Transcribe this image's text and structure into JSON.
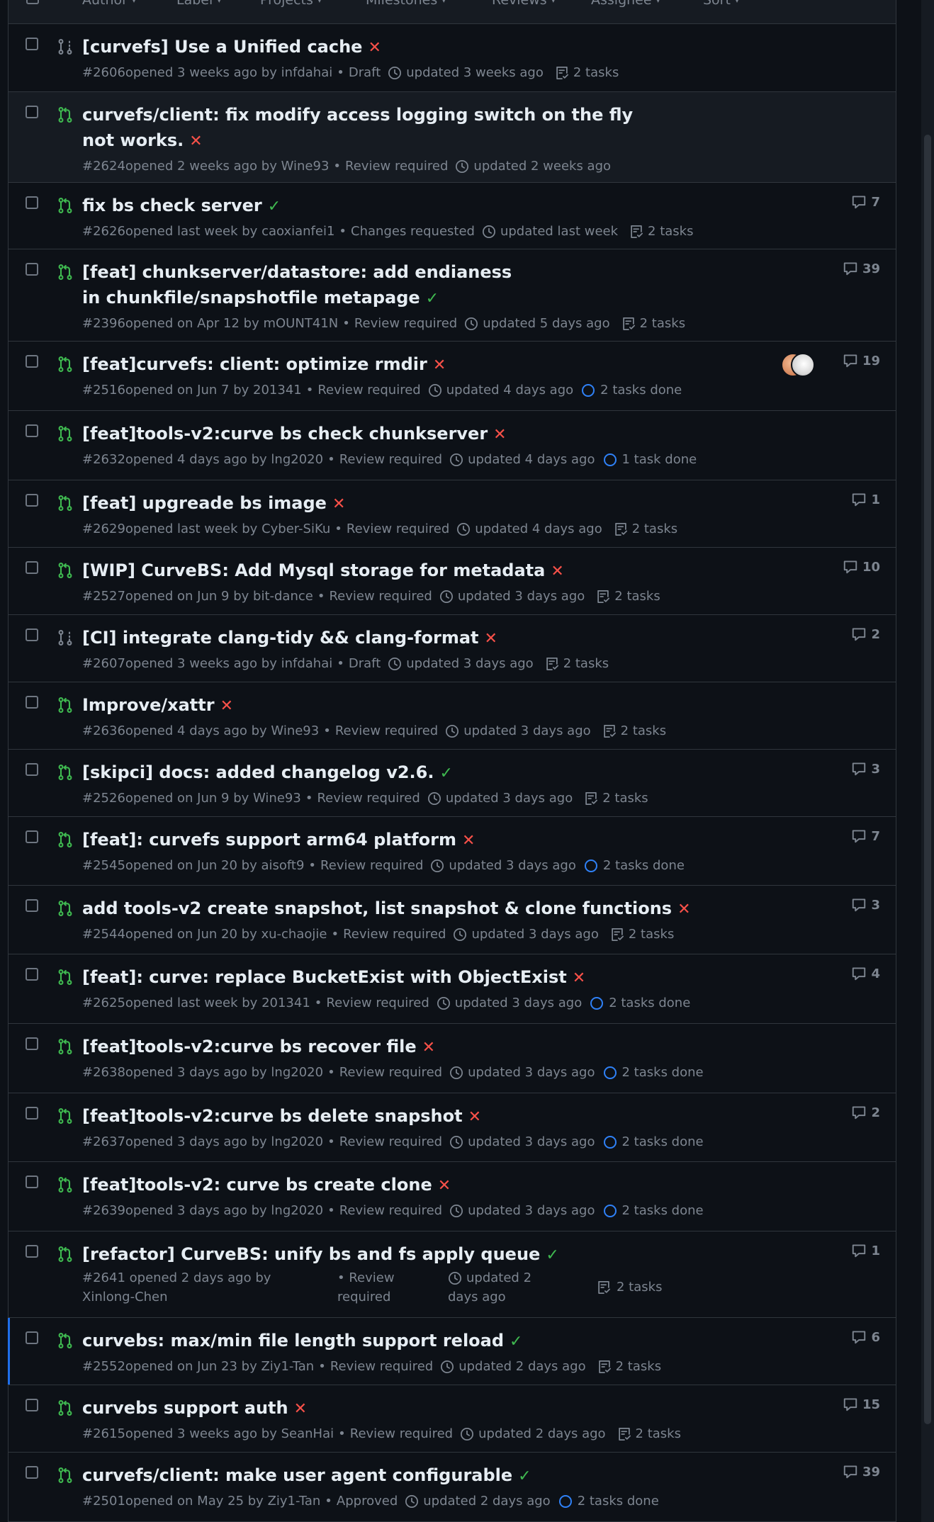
{
  "filter_bar": {
    "items": [
      "Author",
      "Label",
      "Projects",
      "Milestones",
      "Reviews",
      "Assignee",
      "Sort"
    ]
  },
  "colors": {
    "open_pr": "#3fb950",
    "draft_pr": "#7d8590",
    "failure": "#f85149",
    "success": "#3fb950",
    "tasks_done": "#2f81f7",
    "selected_accent": "#1f6feb"
  },
  "pull_requests": [
    {
      "title": "[curvefs] Use a Unified cache",
      "status": "fail",
      "number": "#2606",
      "opened": "opened 3 weeks ago by",
      "author": "infdahai",
      "review": "Draft",
      "updated": "updated 3 weeks ago",
      "tasks": "2 tasks",
      "tasks_icon": "checklist-icon",
      "comments": "",
      "draft": true
    },
    {
      "title": "curvefs/client: fix modify access logging switch on the fly not works.",
      "status": "fail",
      "number": "#2624",
      "opened": "opened 2 weeks ago by",
      "author": "Wine93",
      "review": "Review required",
      "updated": "updated 2 weeks ago",
      "tasks": "",
      "comments": ""
    },
    {
      "title": "fix bs check server",
      "status": "ok",
      "number": "#2626",
      "opened": "opened last week by",
      "author": "caoxianfei1",
      "review": "Changes requested",
      "updated": "updated last week",
      "tasks": "2 tasks",
      "tasks_icon": "checklist-icon",
      "comments": "7"
    },
    {
      "title": "[feat] chunkserver/datastore: add endianess in chunkfile/snapshotfile metapage",
      "status": "ok",
      "number": "#2396",
      "opened": "opened on Apr 12 by",
      "author": "mOUNT41N",
      "review": "Review required",
      "updated": "updated 5 days ago",
      "tasks": "2 tasks",
      "tasks_icon": "checklist-icon",
      "comments": "39"
    },
    {
      "title": "[feat]curvefs: client: optimize rmdir",
      "status": "fail",
      "number": "#2516",
      "opened": "opened on Jun 7 by",
      "author": "201341",
      "review": "Review required",
      "updated": "updated 4 days ago",
      "tasks": "2 tasks done",
      "tasks_icon": "tasks-done-icon",
      "comments": "19",
      "avatars": true
    },
    {
      "title": "[feat]tools-v2:curve bs check chunkserver",
      "status": "fail",
      "number": "#2632",
      "opened": "opened 4 days ago by",
      "author": "lng2020",
      "review": "Review required",
      "updated": "updated 4 days ago",
      "tasks": "1 task done",
      "tasks_icon": "tasks-done-icon",
      "comments": ""
    },
    {
      "title": "[feat] upgreade bs image",
      "status": "fail",
      "number": "#2629",
      "opened": "opened last week by",
      "author": "Cyber-SiKu",
      "review": "Review required",
      "updated": "updated 4 days ago",
      "tasks": "2 tasks",
      "tasks_icon": "checklist-icon",
      "comments": "1"
    },
    {
      "title": "[WIP] CurveBS: Add Mysql storage for metadata",
      "status": "fail",
      "number": "#2527",
      "opened": "opened on Jun 9 by",
      "author": "bit-dance",
      "review": "Review required",
      "updated": "updated 3 days ago",
      "tasks": "2 tasks",
      "tasks_icon": "checklist-icon",
      "comments": "10"
    },
    {
      "title": "[CI] integrate clang-tidy && clang-format",
      "status": "fail",
      "number": "#2607",
      "opened": "opened 3 weeks ago by",
      "author": "infdahai",
      "review": "Draft",
      "updated": "updated 3 days ago",
      "tasks": "2 tasks",
      "tasks_icon": "checklist-icon",
      "comments": "2",
      "draft": true
    },
    {
      "title": "Improve/xattr",
      "status": "fail",
      "number": "#2636",
      "opened": "opened 4 days ago by",
      "author": "Wine93",
      "review": "Review required",
      "updated": "updated 3 days ago",
      "tasks": "2 tasks",
      "tasks_icon": "checklist-icon",
      "comments": ""
    },
    {
      "title": "[skipci] docs: added changelog v2.6.",
      "status": "ok",
      "number": "#2526",
      "opened": "opened on Jun 9 by",
      "author": "Wine93",
      "review": "Review required",
      "updated": "updated 3 days ago",
      "tasks": "2 tasks",
      "tasks_icon": "checklist-icon",
      "comments": "3"
    },
    {
      "title": "[feat]: curvefs support arm64 platform",
      "status": "fail",
      "number": "#2545",
      "opened": "opened on Jun 20 by",
      "author": "aisoft9",
      "review": "Review required",
      "updated": "updated 3 days ago",
      "tasks": "2 tasks done",
      "tasks_icon": "tasks-done-icon",
      "comments": "7"
    },
    {
      "title": "add tools-v2 create snapshot, list snapshot & clone functions",
      "status": "fail",
      "number": "#2544",
      "opened": "opened on Jun 20 by",
      "author": "xu-chaojie",
      "review": "Review required",
      "updated": "updated 3 days ago",
      "tasks": "2 tasks",
      "tasks_icon": "checklist-icon",
      "comments": "3"
    },
    {
      "title": "[feat]: curve: replace BucketExist with ObjectExist",
      "status": "fail",
      "number": "#2625",
      "opened": "opened last week by",
      "author": "201341",
      "review": "Review required",
      "updated": "updated 3 days ago",
      "tasks": "2 tasks done",
      "tasks_icon": "tasks-done-icon",
      "comments": "4"
    },
    {
      "title": "[feat]tools-v2:curve bs recover file",
      "status": "fail",
      "number": "#2638",
      "opened": "opened 3 days ago by",
      "author": "lng2020",
      "review": "Review required",
      "updated": "updated 3 days ago",
      "tasks": "2 tasks done",
      "tasks_icon": "tasks-done-icon",
      "comments": ""
    },
    {
      "title": "[feat]tools-v2:curve bs delete snapshot",
      "status": "fail",
      "number": "#2637",
      "opened": "opened 3 days ago by",
      "author": "lng2020",
      "review": "Review required",
      "updated": "updated 3 days ago",
      "tasks": "2 tasks done",
      "tasks_icon": "tasks-done-icon",
      "comments": "2"
    },
    {
      "title": "[feat]tools-v2: curve bs create clone",
      "status": "fail",
      "number": "#2639",
      "opened": "opened 3 days ago by",
      "author": "lng2020",
      "review": "Review required",
      "updated": "updated 3 days ago",
      "tasks": "2 tasks done",
      "tasks_icon": "tasks-done-icon",
      "comments": ""
    },
    {
      "title": "[refactor] CurveBS: unify bs and fs apply queue",
      "status": "ok",
      "number": "#2641",
      "opened": "opened 2 days ago by",
      "author": "Xinlong-Chen",
      "review": "Review required",
      "updated": "updated 2 days ago",
      "tasks": "2 tasks",
      "tasks_icon": "checklist-icon",
      "comments": "1",
      "wrapped": true
    },
    {
      "title": "curvebs: max/min file length support reload",
      "status": "ok",
      "number": "#2552",
      "opened": "opened on Jun 23 by",
      "author": "Ziy1-Tan",
      "review": "Review required",
      "updated": "updated 2 days ago",
      "tasks": "2 tasks",
      "tasks_icon": "checklist-icon",
      "comments": "6",
      "selected": true
    },
    {
      "title": "curvebs support auth",
      "status": "fail",
      "number": "#2615",
      "opened": "opened 3 weeks ago by",
      "author": "SeanHai",
      "review": "Review required",
      "updated": "updated 2 days ago",
      "tasks": "2 tasks",
      "tasks_icon": "checklist-icon",
      "comments": "15"
    },
    {
      "title": "curvefs/client: make user agent configurable",
      "status": "ok",
      "number": "#2501",
      "opened": "opened on May 25 by",
      "author": "Ziy1-Tan",
      "review": "Approved",
      "updated": "updated 2 days ago",
      "tasks": "2 tasks done",
      "tasks_icon": "tasks-done-icon",
      "comments": "39"
    }
  ]
}
